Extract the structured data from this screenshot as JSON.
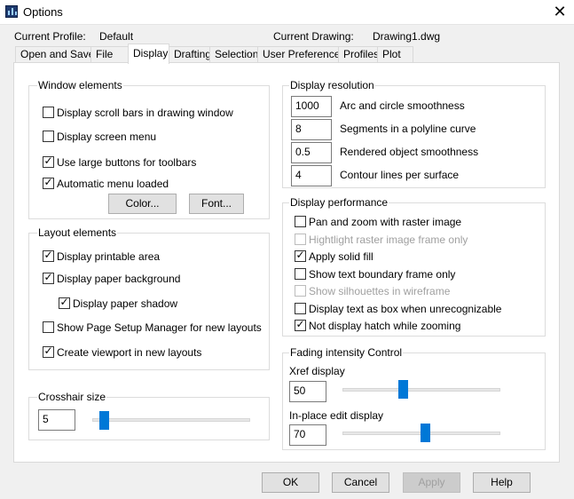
{
  "window": {
    "title": "Options",
    "close_glyph": "✕",
    "icon": "app-icon"
  },
  "header": {
    "profile_label": "Current Profile:",
    "profile_value": "Default",
    "drawing_label": "Current Drawing:",
    "drawing_value": "Drawing1.dwg"
  },
  "tabs": [
    {
      "label": "Open and Save"
    },
    {
      "label": "File"
    },
    {
      "label": "Display",
      "active": true
    },
    {
      "label": "Drafting"
    },
    {
      "label": "Selection"
    },
    {
      "label": "User Preferences"
    },
    {
      "label": "Profiles"
    },
    {
      "label": "Plot"
    }
  ],
  "window_elements": {
    "title": "Window elements",
    "items": [
      {
        "label": "Display scroll bars in drawing window",
        "checked": false
      },
      {
        "label": "Display screen menu",
        "checked": false
      },
      {
        "label": "Use large buttons for toolbars",
        "checked": true
      },
      {
        "label": "Automatic menu loaded",
        "checked": true
      }
    ],
    "color_button": "Color...",
    "font_button": "Font..."
  },
  "layout_elements": {
    "title": "Layout elements",
    "items": [
      {
        "label": "Display printable area",
        "checked": true
      },
      {
        "label": "Display paper background",
        "checked": true
      },
      {
        "label": "Display paper shadow",
        "checked": true
      },
      {
        "label": "Show Page Setup Manager for new layouts",
        "checked": false
      },
      {
        "label": "Create viewport in new layouts",
        "checked": true
      }
    ]
  },
  "crosshair": {
    "title": "Crosshair size",
    "value": "5",
    "level": 0.05
  },
  "display_resolution": {
    "title": "Display resolution",
    "items": [
      {
        "value": "1000",
        "label": "Arc and circle smoothness"
      },
      {
        "value": "8",
        "label": "Segments in a polyline curve"
      },
      {
        "value": "0.5",
        "label": "Rendered object smoothness"
      },
      {
        "value": "4",
        "label": "Contour lines per surface"
      }
    ]
  },
  "display_performance": {
    "title": "Display performance",
    "items": [
      {
        "label": "Pan and zoom with raster image",
        "checked": false,
        "disabled": false
      },
      {
        "label": "Hightlight raster image frame only",
        "checked": false,
        "disabled": true
      },
      {
        "label": "Apply solid fill",
        "checked": true,
        "disabled": false
      },
      {
        "label": "Show text boundary frame only",
        "checked": false,
        "disabled": false
      },
      {
        "label": "Show silhouettes in wireframe",
        "checked": false,
        "disabled": true
      },
      {
        "label": "Display text as box when unrecognizable",
        "checked": false,
        "disabled": false
      },
      {
        "label": "Not display hatch while zooming",
        "checked": true,
        "disabled": false
      }
    ]
  },
  "fading": {
    "title": "Fading intensity Control",
    "xref_label": "Xref display",
    "xref_value": "50",
    "xref_percent": 50,
    "inplace_label": "In-place edit display",
    "inplace_value": "70",
    "inplace_percent": 70
  },
  "footer": {
    "ok": "OK",
    "cancel": "Cancel",
    "apply": "Apply",
    "help": "Help"
  },
  "colors": {
    "slider_thumb": "#0078d7",
    "disabled_text": "#a0a0a0"
  }
}
